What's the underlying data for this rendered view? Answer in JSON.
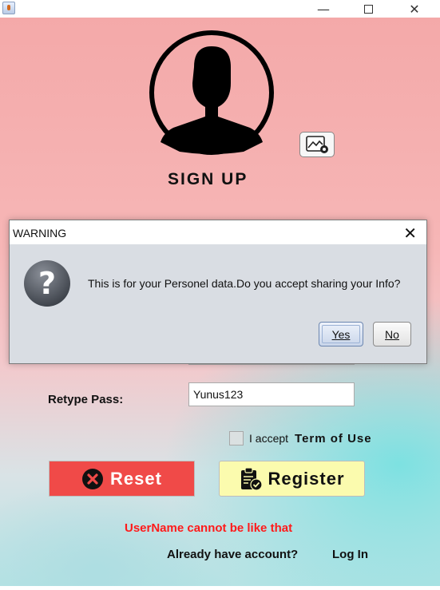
{
  "window": {
    "minimize_glyph": "—",
    "close_glyph": "✕"
  },
  "form": {
    "title": "SIGN UP",
    "retype_label": "Retype Pass:",
    "retype_value": "Yunus123",
    "accept_text": "I accept",
    "term_link": "Term of Use",
    "reset_label": "Reset",
    "register_label": "Register",
    "error_message": "UserName cannot be like that",
    "account_text": "Already have account?",
    "login_link": "Log In"
  },
  "dialog": {
    "title": "WARNING",
    "close_glyph": "✕",
    "message": "This is for your Personel data.Do you accept sharing your Info?",
    "yes_label": "Yes",
    "no_label": "No",
    "icon_glyph": "?"
  },
  "colors": {
    "reset_button": "#f04a48",
    "register_button": "#fbfbae",
    "error_text": "#ff1a1a"
  }
}
